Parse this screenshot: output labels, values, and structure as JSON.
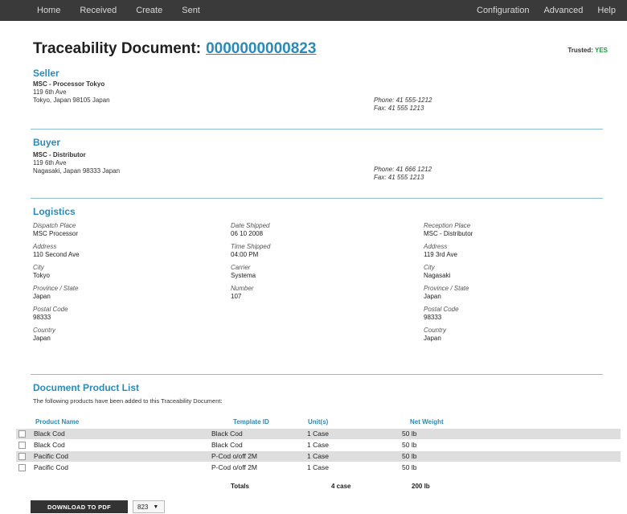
{
  "nav": {
    "left": [
      "Home",
      "Received",
      "Create",
      "Sent"
    ],
    "right": [
      "Configuration",
      "Advanced",
      "Help"
    ]
  },
  "doc": {
    "title": "Traceability Document:",
    "number": "0000000000823",
    "trusted_label": "Trusted:",
    "trusted_value": "YES"
  },
  "seller": {
    "heading": "Seller",
    "name": "MSC - Processor Tokyo",
    "street": "119 6th Ave",
    "city_line": "Tokyo, Japan 98105 Japan",
    "phone": "Phone: 41 555-1212",
    "fax": "Fax: 41 555 1213"
  },
  "buyer": {
    "heading": "Buyer",
    "name": "MSC - Distributor",
    "street": "119 6th Ave",
    "city_line": "Nagasaki, Japan 98333 Japan",
    "phone": "Phone: 41 666 1212",
    "fax": "Fax: 41 555 1213"
  },
  "logistics": {
    "heading": "Logistics",
    "dispatch": [
      {
        "label": "Dispatch Place",
        "value": "MSC Processor"
      },
      {
        "label": "Address",
        "value": "110 Second Ave"
      },
      {
        "label": "City",
        "value": "Tokyo"
      },
      {
        "label": "Province / State",
        "value": "Japan"
      },
      {
        "label": "Postal Code",
        "value": "98333"
      },
      {
        "label": "Country",
        "value": "Japan"
      }
    ],
    "shipping": [
      {
        "label": "Date Shipped",
        "value": "06 10 2008"
      },
      {
        "label": "Time Shipped",
        "value": "04:00 PM"
      },
      {
        "label": "Carrier",
        "value": "Systema"
      },
      {
        "label": "Number",
        "value": "107"
      }
    ],
    "reception": [
      {
        "label": "Reception Place",
        "value": "MSC - Distributor"
      },
      {
        "label": "Address",
        "value": "119 3rd Ave"
      },
      {
        "label": "City",
        "value": "Nagasaki"
      },
      {
        "label": "Province / State",
        "value": "Japan"
      },
      {
        "label": "Postal Code",
        "value": "98333"
      },
      {
        "label": "Country",
        "value": "Japan"
      }
    ]
  },
  "products": {
    "heading": "Document Product List",
    "intro": "The following products have been added to this Traceability Document:",
    "columns": [
      "Product Name",
      "Template ID",
      "Unit(s)",
      "Net Weight"
    ],
    "rows": [
      {
        "name": "Black Cod",
        "template": "Black Cod",
        "units": "1 Case",
        "weight": "50 lb"
      },
      {
        "name": "Black Cod",
        "template": "Black Cod",
        "units": "1 Case",
        "weight": "50 lb"
      },
      {
        "name": "Pacific Cod",
        "template": "P-Cod o/off 2M",
        "units": "1 Case",
        "weight": "50 lb"
      },
      {
        "name": "Pacific Cod",
        "template": "P-Cod o/off 2M",
        "units": "1 Case",
        "weight": "50 lb"
      }
    ],
    "totals_label": "Totals",
    "total_units": "4 case",
    "total_weight": "200 lb"
  },
  "footer": {
    "download_label": "DOWNLOAD TO PDF",
    "select_value": "823"
  }
}
